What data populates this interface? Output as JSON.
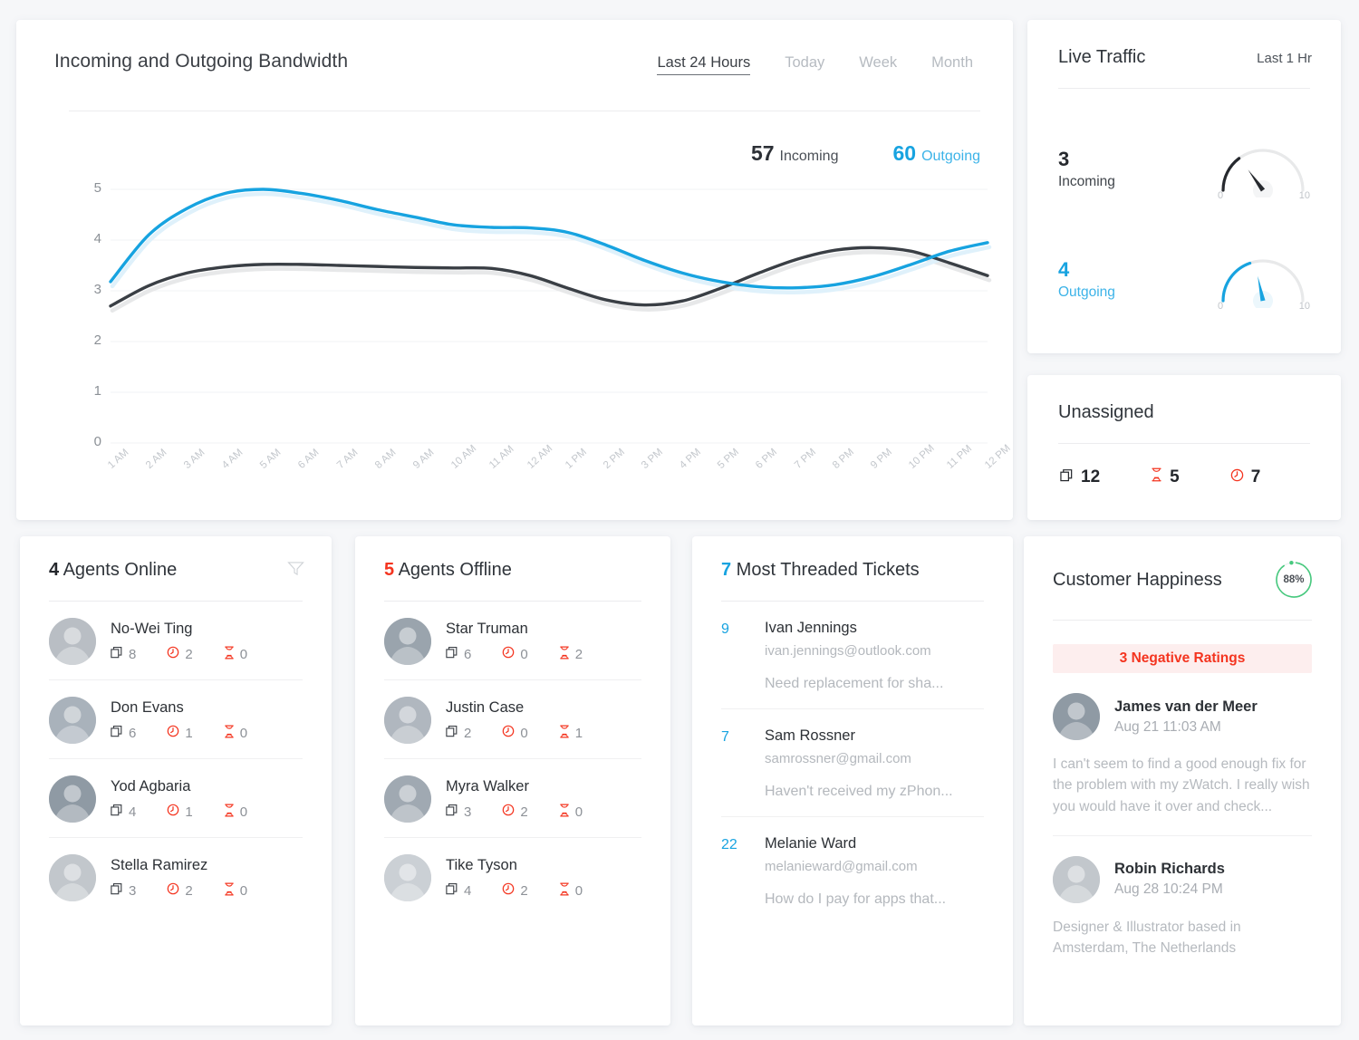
{
  "bandwidth": {
    "title": "Incoming and Outgoing Bandwidth",
    "tabs": [
      {
        "label": "Last 24 Hours",
        "active": true
      },
      {
        "label": "Today",
        "active": false
      },
      {
        "label": "Week",
        "active": false
      },
      {
        "label": "Month",
        "active": false
      }
    ],
    "legend": {
      "incoming_value": "57",
      "incoming_label": "Incoming",
      "outgoing_value": "60",
      "outgoing_label": "Outgoing"
    },
    "colors": {
      "incoming": "#3a3f45",
      "outgoing": "#17a3e0"
    }
  },
  "chart_data": {
    "type": "line",
    "title": "Incoming and Outgoing Bandwidth",
    "xlabel": "",
    "ylabel": "",
    "ylim": [
      0,
      5
    ],
    "yticks": [
      "0",
      "1",
      "2",
      "3",
      "4",
      "5"
    ],
    "grid": true,
    "legend_position": "top-right",
    "x": [
      "1 AM",
      "2 AM",
      "3 AM",
      "4 AM",
      "5 AM",
      "6 AM",
      "7 AM",
      "8 AM",
      "9 AM",
      "10 AM",
      "11 AM",
      "12 AM",
      "1 PM",
      "2 PM",
      "3 PM",
      "4 PM",
      "5 PM",
      "6 PM",
      "7 PM",
      "8 PM",
      "9 PM",
      "10 PM",
      "11 PM",
      "12 PM"
    ],
    "series": [
      {
        "name": "Incoming",
        "color": "#3a3f45",
        "values": [
          2.7,
          3.1,
          3.35,
          3.47,
          3.52,
          3.52,
          3.5,
          3.48,
          3.46,
          3.45,
          3.44,
          3.3,
          3.05,
          2.82,
          2.72,
          2.8,
          3.05,
          3.35,
          3.62,
          3.8,
          3.85,
          3.78,
          3.55,
          3.3
        ]
      },
      {
        "name": "Outgoing",
        "color": "#17a3e0",
        "values": [
          3.18,
          4.1,
          4.62,
          4.92,
          5.0,
          4.92,
          4.78,
          4.6,
          4.45,
          4.3,
          4.25,
          4.24,
          4.15,
          3.9,
          3.6,
          3.35,
          3.18,
          3.08,
          3.06,
          3.12,
          3.28,
          3.52,
          3.78,
          3.95
        ]
      }
    ]
  },
  "live_traffic": {
    "title": "Live Traffic",
    "range": "Last 1 Hr",
    "gauges": [
      {
        "value": "3",
        "label": "Incoming",
        "min": "0",
        "max": "10",
        "color": "#26292e"
      },
      {
        "value": "4",
        "label": "Outgoing",
        "min": "0",
        "max": "10",
        "color": "#17a3e0"
      }
    ]
  },
  "unassigned": {
    "title": "Unassigned",
    "stats": [
      {
        "icon": "tickets-icon",
        "value": "12"
      },
      {
        "icon": "hourglass-icon",
        "value": "5"
      },
      {
        "icon": "clock-icon",
        "value": "7"
      }
    ]
  },
  "agents_online": {
    "count": "4",
    "title_rest": " Agents Online",
    "filter_icon": "filter-icon",
    "rows": [
      {
        "name": "No-Wei Ting",
        "tickets": "8",
        "overdue": "2",
        "pending": "0"
      },
      {
        "name": "Don Evans",
        "tickets": "6",
        "overdue": "1",
        "pending": "0"
      },
      {
        "name": "Yod Agbaria",
        "tickets": "4",
        "overdue": "1",
        "pending": "0"
      },
      {
        "name": "Stella Ramirez",
        "tickets": "3",
        "overdue": "2",
        "pending": "0"
      }
    ]
  },
  "agents_offline": {
    "count": "5",
    "title_rest": " Agents Offline",
    "rows": [
      {
        "name": "Star Truman",
        "tickets": "6",
        "overdue": "0",
        "pending": "2"
      },
      {
        "name": "Justin Case",
        "tickets": "2",
        "overdue": "0",
        "pending": "1"
      },
      {
        "name": "Myra Walker",
        "tickets": "3",
        "overdue": "2",
        "pending": "0"
      },
      {
        "name": "Tike Tyson",
        "tickets": "4",
        "overdue": "2",
        "pending": "0"
      }
    ]
  },
  "tickets": {
    "count": "7",
    "title_rest": " Most Threaded Tickets",
    "rows": [
      {
        "threads": "9",
        "name": "Ivan Jennings",
        "email": "ivan.jennings@outlook.com",
        "subject": "Need replacement for sha..."
      },
      {
        "threads": "7",
        "name": "Sam Rossner",
        "email": "samrossner@gmail.com",
        "subject": "Haven't received my zPhon..."
      },
      {
        "threads": "22",
        "name": "Melanie Ward",
        "email": "melanieward@gmail.com",
        "subject": "How do I pay for apps that..."
      }
    ]
  },
  "happiness": {
    "title": "Customer Happiness",
    "percent": "88%",
    "ring_color": "#47c97e",
    "negative_pill": "3 Negative Ratings",
    "reviews": [
      {
        "name": "James van der Meer",
        "time": "Aug 21 11:03 AM",
        "body": "I can't seem to find a good enough fix for the problem with my zWatch. I really wish you would have it over and check..."
      },
      {
        "name": "Robin Richards",
        "time": "Aug 28 10:24 PM",
        "body": "Designer & Illustrator based in Amsterdam, The Netherlands"
      }
    ]
  }
}
